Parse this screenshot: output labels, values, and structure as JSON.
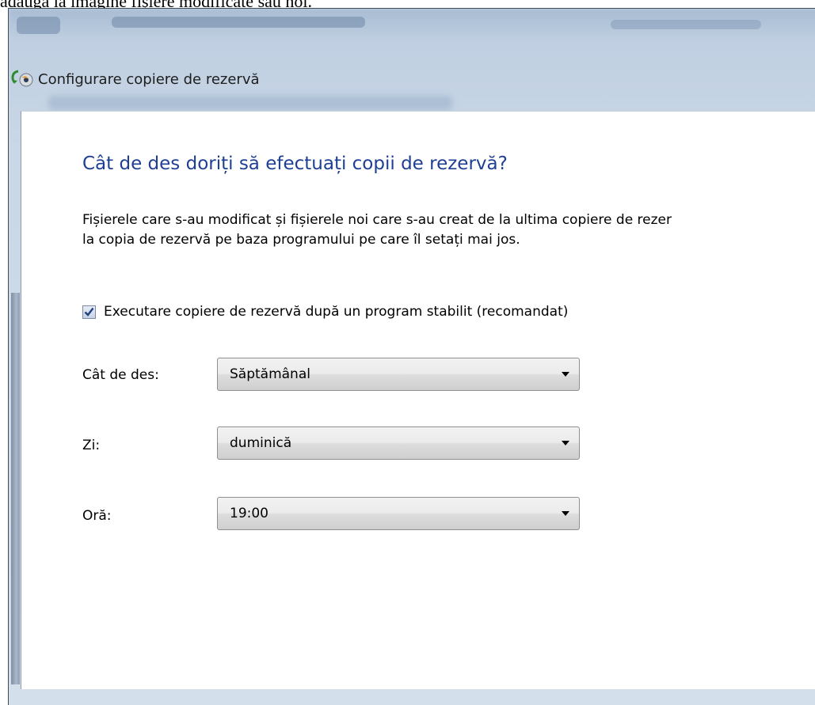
{
  "clipped_caption": "adaugă la imagine fișiere modificate sau noi.",
  "window": {
    "title": "Configurare copiere de rezervă"
  },
  "dialog": {
    "heading": "Cât de des doriți să efectuați copii de rezervă?",
    "description_line1": "Fișierele care s-au modificat și fișierele noi care s-au creat de la ultima copiere de rezer",
    "description_line2": "la copia de rezervă pe baza programului pe care îl setați mai jos.",
    "schedule_checkbox": {
      "label": "Executare copiere de rezervă după un program stabilit (recomandat)",
      "checked": true
    },
    "fields": {
      "frequency": {
        "label": "Cât de des:",
        "value": "Săptămânal"
      },
      "day": {
        "label": "Zi:",
        "value": "duminică"
      },
      "time": {
        "label": "Oră:",
        "value": "19:00"
      }
    }
  },
  "colors": {
    "heading": "#1e3f93",
    "panel_background": "#ffffff",
    "chrome_background": "#c9d7e6"
  },
  "icons": {
    "app_icon": "backup-icon",
    "checkbox_mark": "check-icon",
    "dropdown_arrow": "chevron-down-icon"
  }
}
